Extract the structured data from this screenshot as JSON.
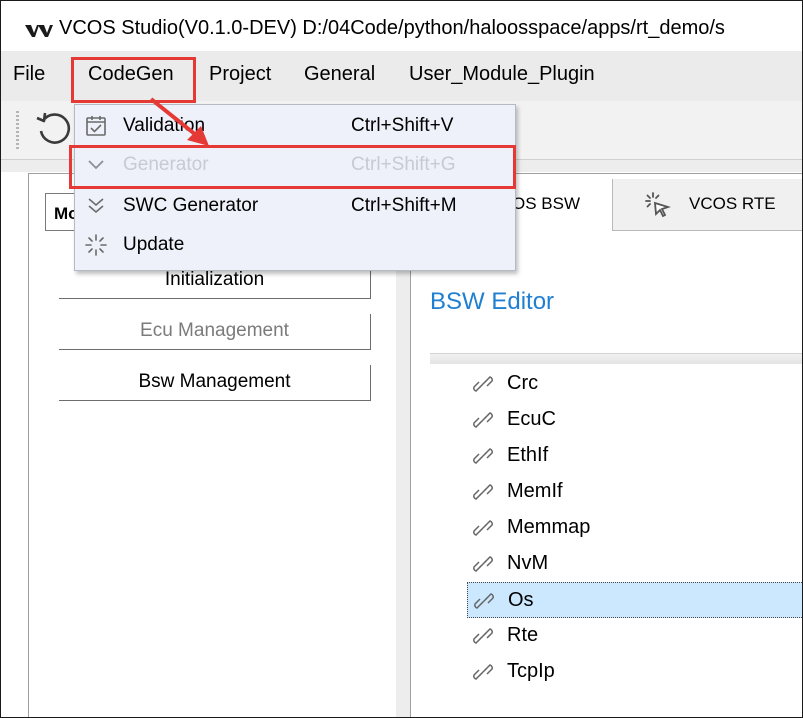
{
  "window": {
    "title": "VCOS Studio(V0.1.0-DEV)  D:/04Code/python/haloosspace/apps/rt_demo/s"
  },
  "menubar": {
    "items": [
      {
        "label": "File"
      },
      {
        "label": "CodeGen"
      },
      {
        "label": "Project"
      },
      {
        "label": "General"
      },
      {
        "label": "User_Module_Plugin"
      }
    ]
  },
  "toolbar": {
    "refresh_icon": "refresh-icon"
  },
  "codegen_menu": {
    "items": [
      {
        "label": "Validation",
        "shortcut": "Ctrl+Shift+V",
        "icon": "checklist-icon",
        "enabled": true
      },
      {
        "label": "Generator",
        "shortcut": "Ctrl+Shift+G",
        "icon": "chevron-down-icon",
        "enabled": false
      },
      {
        "label": "SWC Generator",
        "shortcut": "Ctrl+Shift+M",
        "icon": "double-chevron-down-icon",
        "enabled": true
      },
      {
        "label": "Update",
        "shortcut": "",
        "icon": "spinner-icon",
        "enabled": true
      }
    ]
  },
  "left_panel": {
    "mode_label": "Mo",
    "buttons": [
      {
        "label": "Initialization",
        "enabled": true
      },
      {
        "label": "Ecu Management",
        "enabled": false
      },
      {
        "label": "Bsw Management",
        "enabled": true
      }
    ]
  },
  "tabs": [
    {
      "label": "OS BSW",
      "active": true
    },
    {
      "label": "VCOS RTE",
      "active": false,
      "icon": "cursor-click-icon"
    }
  ],
  "editor": {
    "title": "BSW Editor",
    "title_color": "#1f7fd1",
    "modules": [
      {
        "label": "Crc",
        "selected": false
      },
      {
        "label": "EcuC",
        "selected": false
      },
      {
        "label": "EthIf",
        "selected": false
      },
      {
        "label": "MemIf",
        "selected": false
      },
      {
        "label": "Memmap",
        "selected": false
      },
      {
        "label": "NvM",
        "selected": false
      },
      {
        "label": "Os",
        "selected": true
      },
      {
        "label": "Rte",
        "selected": false
      },
      {
        "label": "TcpIp",
        "selected": false
      }
    ]
  },
  "colors": {
    "highlight_red": "#e53935",
    "selection_bg": "#cce8ff",
    "menu_bg": "#eef1f9",
    "disabled_text": "#c6cad2"
  }
}
